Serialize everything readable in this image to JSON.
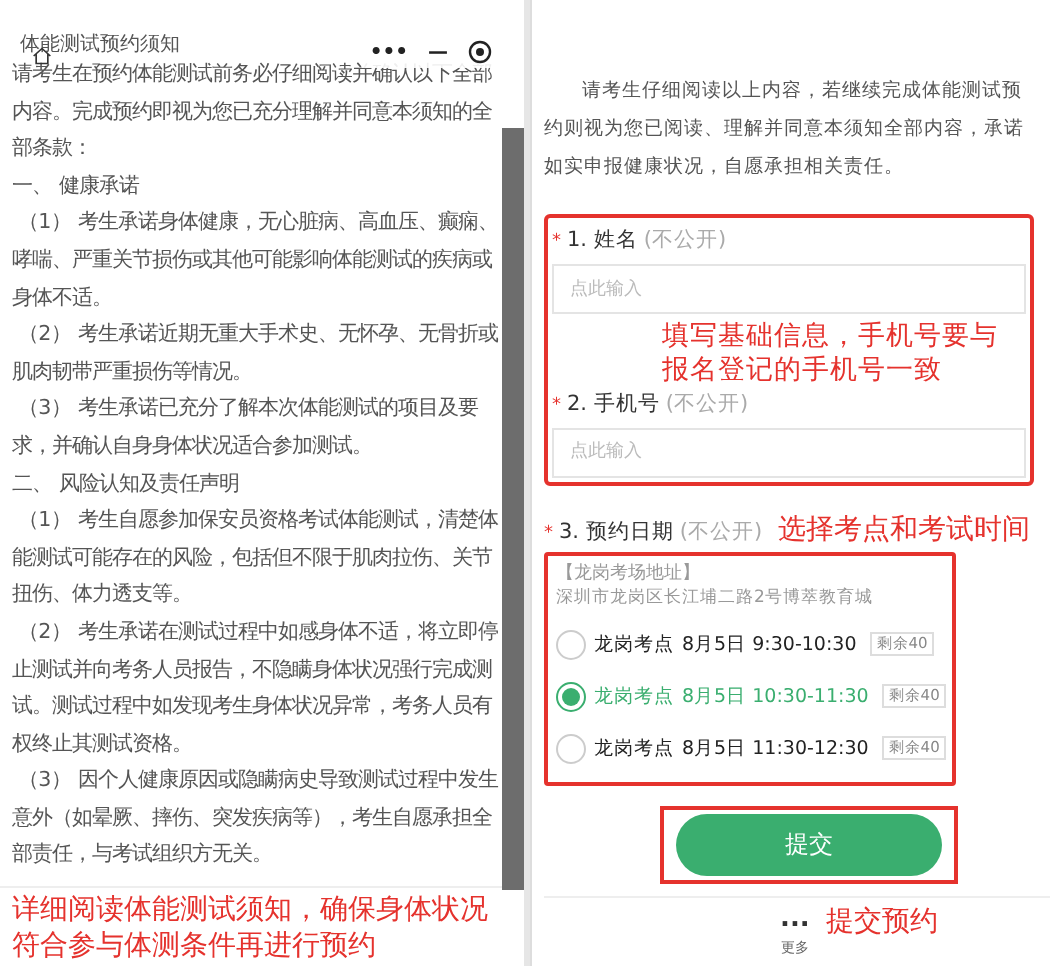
{
  "notice": {
    "title": "体能测试预约须知",
    "capsule": {
      "more": "•••",
      "minimize": "—"
    },
    "paragraphs": [
      {
        "kind": "intro",
        "text": "请考生在预约体能测试前务必仔细阅读并确认以下全部内容。完成预约即视为您已充分理解并同意本须知的全部条款："
      },
      {
        "kind": "heading",
        "text": "一、 健康承诺"
      },
      {
        "kind": "item",
        "text": "（1） 考生承诺身体健康，无心脏病、高血压、癫痫、哮喘、严重关节损伤或其他可能影响体能测试的疾病或身体不适。"
      },
      {
        "kind": "item",
        "text": "（2） 考生承诺近期无重大手术史、无怀孕、无骨折或肌肉韧带严重损伤等情况。"
      },
      {
        "kind": "item",
        "text": "（3） 考生承诺已充分了解本次体能测试的项目及要求，并确认自身身体状况适合参加测试。"
      },
      {
        "kind": "heading",
        "text": "二、 风险认知及责任声明"
      },
      {
        "kind": "item",
        "text": "（1） 考生自愿参加保安员资格考试体能测试，清楚体能测试可能存在的风险，包括但不限于肌肉拉伤、关节扭伤、体力透支等。"
      },
      {
        "kind": "item",
        "text": "（2） 考生承诺在测试过程中如感身体不适，将立即停止测试并向考务人员报告，不隐瞒身体状况强行完成测试。测试过程中如发现考生身体状况异常，考务人员有权终止其测试资格。"
      },
      {
        "kind": "item",
        "text": "（3） 因个人健康原因或隐瞒病史导致测试过程中发生意外（如晕厥、摔伤、突发疾病等），考生自愿承担全部责任，与考试组织方无关。"
      }
    ],
    "annotation": "详细阅读体能测试须知，确保身体状况符合参与体测条件再进行预约"
  },
  "form": {
    "confirmation": "请考生仔细阅读以上内容，若继续完成体能测试预约则视为您已阅读、理解并同意本须知全部内容，承诺如实申报健康状况，自愿承担相关责任。",
    "fields": [
      {
        "required": "*",
        "label": "1. 姓名",
        "note": "(不公开)",
        "placeholder": "点此输入"
      },
      {
        "required": "*",
        "label": "2. 手机号",
        "note": "(不公开)",
        "placeholder": "点此输入"
      }
    ],
    "fields_annotation": "填写基础信息，手机号要与报名登记的手机号一致",
    "date": {
      "required": "*",
      "label": "3. 预约日期",
      "note": "(不公开)",
      "annotation": "选择考点和考试时间",
      "venue": "【龙岗考场地址】",
      "address": "深圳市龙岗区长江埔二路2号博萃教育城",
      "options": [
        {
          "site": "龙岗考点",
          "time": "8月5日 9:30-10:30",
          "remaining": "剩余40",
          "selected": false
        },
        {
          "site": "龙岗考点",
          "time": "8月5日 10:30-11:30",
          "remaining": "剩余40",
          "selected": true
        },
        {
          "site": "龙岗考点",
          "time": "8月5日 11:30-12:30",
          "remaining": "剩余40",
          "selected": false
        }
      ]
    },
    "submit": "提交",
    "submit_annotation": "提交预约",
    "more": {
      "dots": "...",
      "label": "更多"
    }
  }
}
